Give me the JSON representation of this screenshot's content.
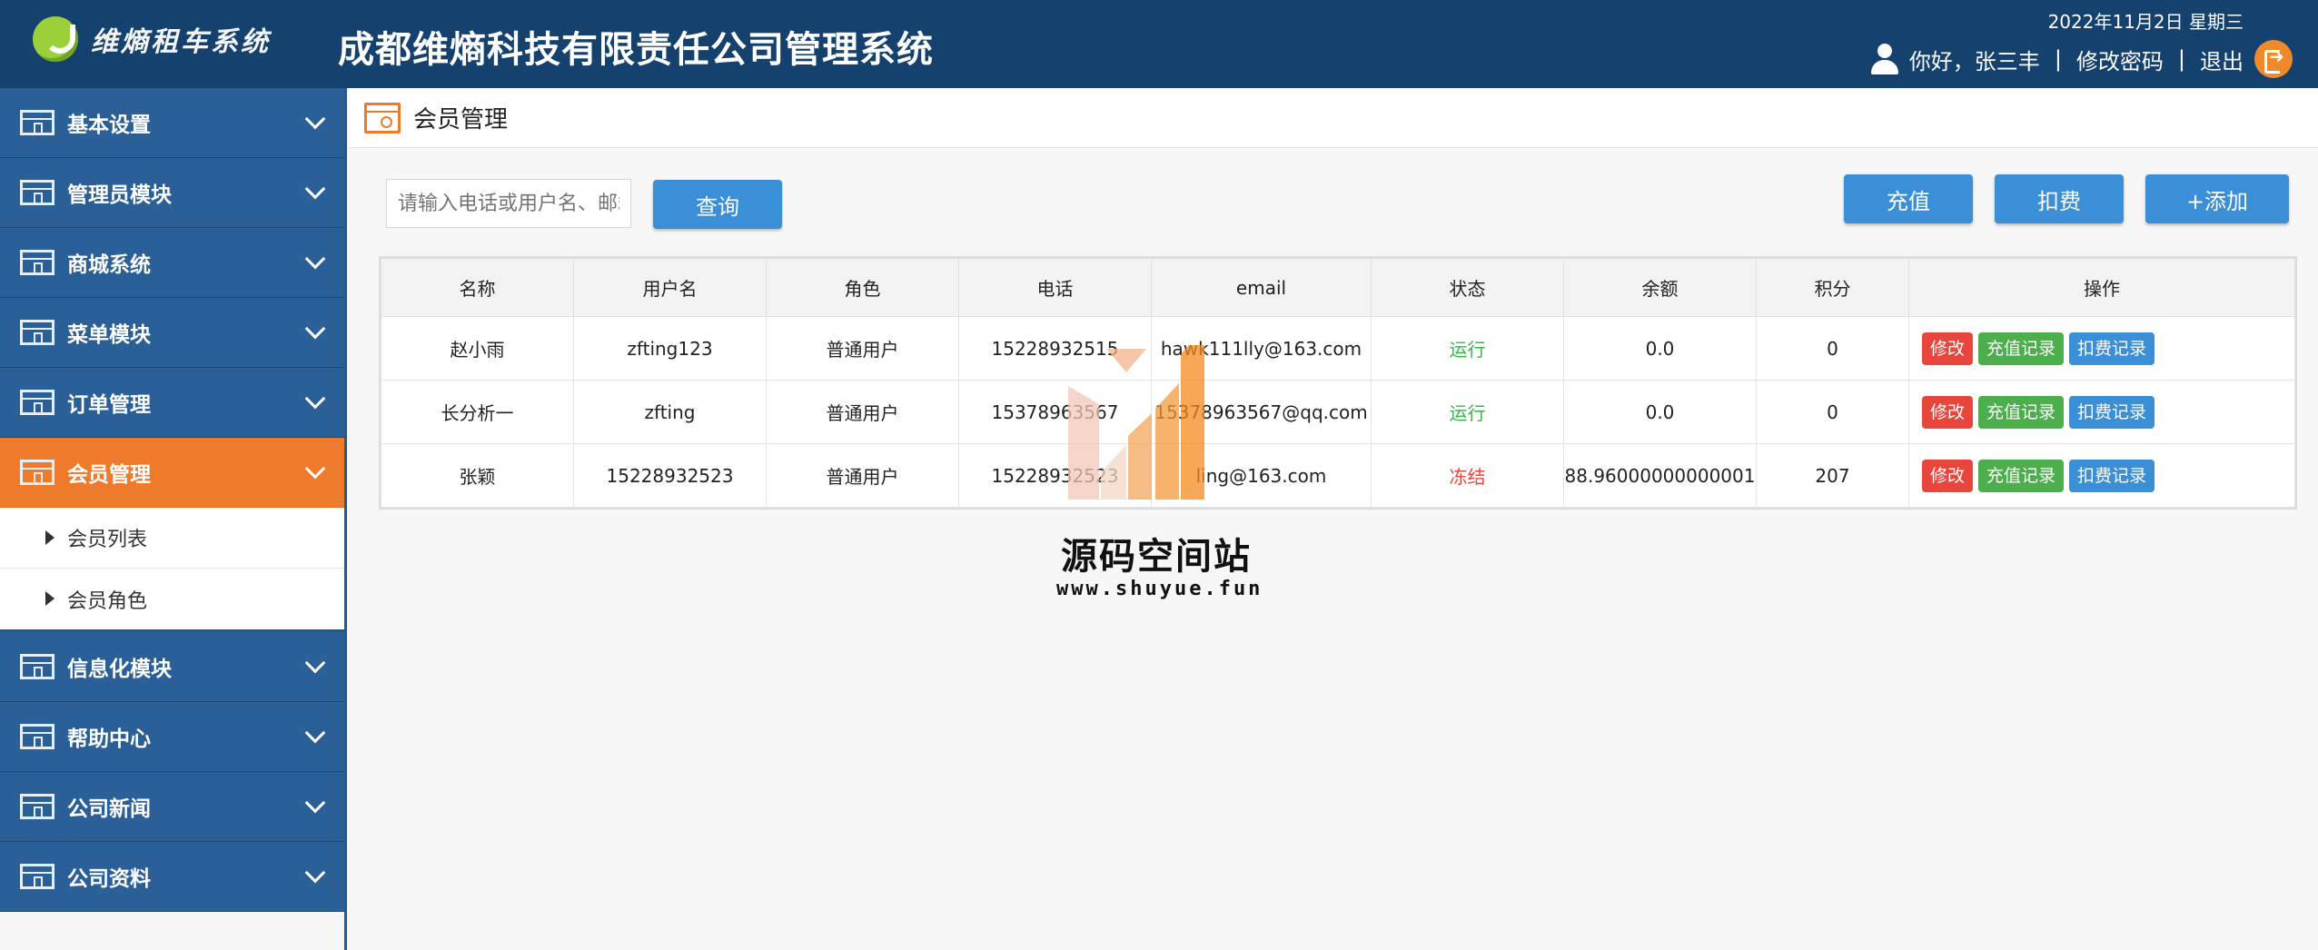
{
  "header": {
    "logo_text": "维熵租车系统",
    "app_title": "成都维熵科技有限责任公司管理系统",
    "date": "2022年11月2日 星期三",
    "greeting": "你好，张三丰",
    "separator": "|",
    "change_password": "修改密码",
    "logout": "退出",
    "accent": "#f0892a"
  },
  "sidebar": {
    "items": [
      {
        "label": "基本设置",
        "icon": "window-icon"
      },
      {
        "label": "管理员模块",
        "icon": "window-icon"
      },
      {
        "label": "商城系统",
        "icon": "window-icon"
      },
      {
        "label": "菜单模块",
        "icon": "window-icon"
      },
      {
        "label": "订单管理",
        "icon": "window-icon"
      },
      {
        "label": "会员管理",
        "icon": "window-icon",
        "active": true
      },
      {
        "label": "信息化模块",
        "icon": "window-icon"
      },
      {
        "label": "帮助中心",
        "icon": "window-icon"
      },
      {
        "label": "公司新闻",
        "icon": "window-icon"
      },
      {
        "label": "公司资料",
        "icon": "window-icon"
      }
    ],
    "sub_items": [
      {
        "label": "会员列表"
      },
      {
        "label": "会员角色"
      }
    ],
    "colors": {
      "nav": "#2b5f97",
      "active": "#ee7a2c"
    }
  },
  "main": {
    "title": "会员管理",
    "search_placeholder": "请输入电话或用户名、邮箱",
    "query_button": "查询",
    "recharge_button": "充值",
    "deduct_button": "扣费",
    "add_button": "+添加"
  },
  "table": {
    "columns": [
      "名称",
      "用户名",
      "角色",
      "电话",
      "email",
      "状态",
      "余额",
      "积分",
      "操作"
    ],
    "rows": [
      {
        "name": "赵小雨",
        "username": "zfting123",
        "role": "普通用户",
        "phone": "15228932515",
        "email": "hawk111lly@163.com",
        "status": "运行",
        "balance": "0.0",
        "points": "0"
      },
      {
        "name": "长分析一",
        "username": "zfting",
        "role": "普通用户",
        "phone": "15378963567",
        "email": "15378963567@qq.com",
        "status": "运行",
        "balance": "0.0",
        "points": "0"
      },
      {
        "name": "张颖",
        "username": "15228932523",
        "role": "普通用户",
        "phone": "15228932523",
        "email": "ling@163.com",
        "status": "冻结",
        "balance": "88.96000000000001",
        "points": "207"
      }
    ],
    "ops": {
      "edit": "修改",
      "recharge_log": "充值记录",
      "deduct_log": "扣费记录"
    },
    "status_colors": {
      "运行": "#3ab54a",
      "冻结": "#e8453c"
    }
  },
  "watermark": {
    "name": "源码空间站",
    "url": "www.shuyue.fun"
  }
}
